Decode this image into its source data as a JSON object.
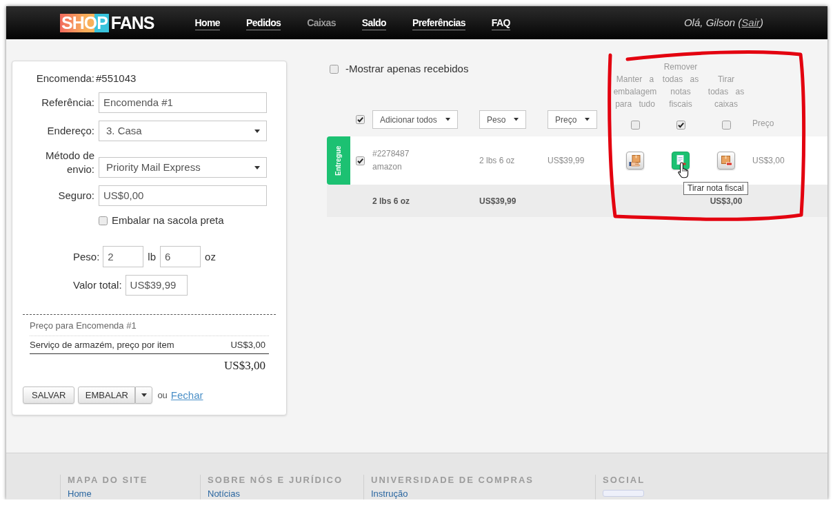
{
  "header": {
    "logo": {
      "highlight": "SHOP",
      "rest": "FANS"
    },
    "nav": [
      {
        "label": "Home",
        "selected": false
      },
      {
        "label": "Pedidos",
        "selected": false
      },
      {
        "label": "Caixas",
        "selected": true
      },
      {
        "label": "Saldo",
        "selected": false
      },
      {
        "label": "Preferências",
        "selected": false
      },
      {
        "label": "FAQ",
        "selected": false
      }
    ],
    "greeting": {
      "text": "Olá, Gilson (",
      "link": "Sair",
      "close": ")"
    }
  },
  "order_form": {
    "order": {
      "label": "Encomenda:",
      "value": "#551043"
    },
    "fields": [
      {
        "kind": "text",
        "label": "Referência:",
        "value": "Encomenda #1"
      },
      {
        "kind": "select",
        "label": "Endereço:",
        "value": "3. Casa"
      },
      {
        "kind": "select",
        "label": "Método de envio:",
        "value": "Priority Mail Express"
      },
      {
        "kind": "text",
        "label": "Seguro:",
        "value": "US$0,00"
      }
    ],
    "black_bag": {
      "label": "Embalar na sacola preta",
      "checked": false
    },
    "weight": {
      "label": "Peso:",
      "pounds": "2",
      "pounds_unit": "lb",
      "ounces": "6",
      "ounces_unit": "oz"
    },
    "total_value": {
      "label": "Valor total:",
      "value": "US$39,99"
    },
    "pricing": {
      "title": "Preço para Encomenda #1",
      "items": [
        {
          "name": "Serviço de armazém, preço por item",
          "price": "US$3,00"
        }
      ],
      "total": "US$3,00"
    },
    "actions": {
      "save": "SALVAR",
      "pack": "EMBALAR",
      "separator": "ou",
      "close_link": "Fechar"
    }
  },
  "items_table": {
    "filter": {
      "label": "-Mostrar apenas recebidos",
      "checked": false
    },
    "select_all": {
      "checked": true
    },
    "dropdowns": [
      "Adicionar todos",
      "Peso",
      "Preço"
    ],
    "option_columns": [
      {
        "label": "Manter a embalagem para tudo",
        "checked": false
      },
      {
        "label": "Remover todas as notas fiscais",
        "checked": true
      },
      {
        "label": "Tirar todas as caixas",
        "checked": false
      }
    ],
    "price_heading": "Preço",
    "rows": [
      {
        "status": "Entregue",
        "checked": true,
        "id": "#2278487",
        "store": "amazon",
        "weight": "2 lbs 6 oz",
        "price": "US$39,99",
        "options": [
          {
            "on": false
          },
          {
            "on": true,
            "tooltip": "Tirar nota fiscal"
          },
          {
            "on": false
          }
        ],
        "service_price": "US$3,00"
      }
    ],
    "totals": {
      "weight": "2 lbs 6 oz",
      "price": "US$39,99",
      "service_price": "US$3,00"
    }
  },
  "footer": {
    "columns": [
      {
        "kind": "links",
        "heading": "MAPA DO SITE",
        "links": [
          "Home"
        ]
      },
      {
        "kind": "links",
        "heading": "SOBRE NÓS E JURÍDICO",
        "links": [
          "Notícias"
        ]
      },
      {
        "kind": "links",
        "heading": "UNIVERSIDADE DE COMPRAS",
        "links": [
          "Instrução"
        ]
      },
      {
        "kind": "social",
        "heading": "SOCIAL"
      }
    ]
  }
}
